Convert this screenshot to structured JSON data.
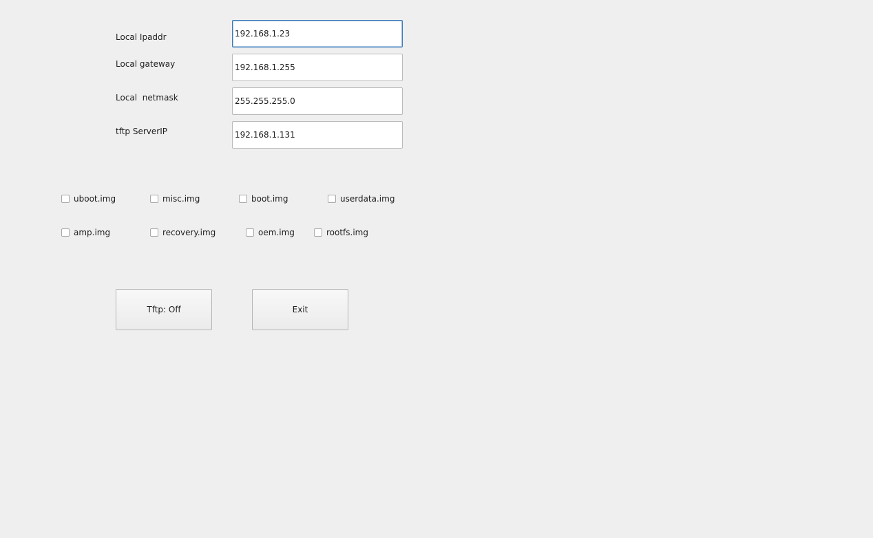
{
  "network": {
    "fields": [
      {
        "label": "Local Ipaddr",
        "value": "192.168.1.23"
      },
      {
        "label": "Local gateway",
        "value": "192.168.1.255"
      },
      {
        "label": "Local  netmask",
        "value": "255.255.255.0"
      },
      {
        "label": "tftp ServerIP",
        "value": "192.168.1.131"
      }
    ]
  },
  "images": {
    "row1": [
      {
        "label": "uboot.img",
        "checked": false
      },
      {
        "label": "misc.img",
        "checked": false
      },
      {
        "label": "boot.img",
        "checked": false
      },
      {
        "label": "userdata.img",
        "checked": false
      }
    ],
    "row2": [
      {
        "label": "amp.img",
        "checked": false
      },
      {
        "label": "recovery.img",
        "checked": false
      },
      {
        "label": "oem.img",
        "checked": false
      },
      {
        "label": "rootfs.img",
        "checked": false
      }
    ]
  },
  "buttons": {
    "tftp_label": "Tftp: Off",
    "exit_label": "Exit"
  },
  "colors": {
    "background": "#efefef",
    "focus_border": "#3a7ab8"
  }
}
